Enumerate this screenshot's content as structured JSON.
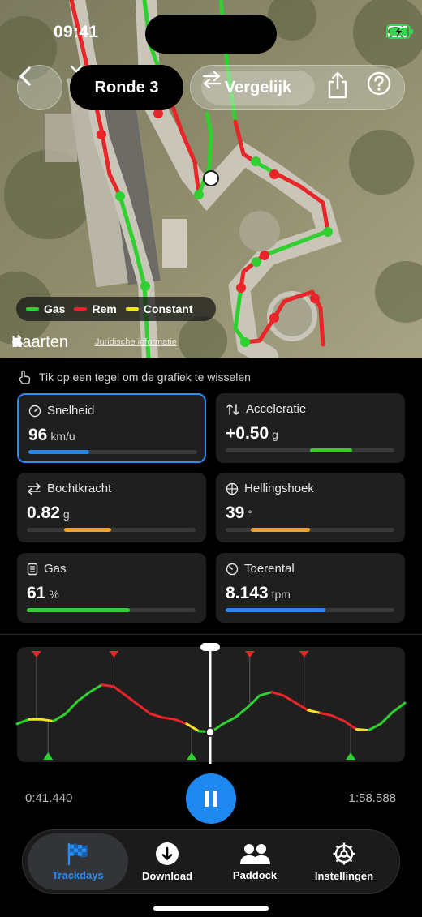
{
  "status": {
    "time": "09:41"
  },
  "header": {
    "lap_label": "Ronde 3",
    "compare_label": "Vergelijk"
  },
  "map": {
    "legend": [
      {
        "label": "Gas",
        "color": "#2fd02f"
      },
      {
        "label": "Rem",
        "color": "#e8262a"
      },
      {
        "label": "Constant",
        "color": "#f2e21f"
      }
    ],
    "maps_brand": "Kaarten",
    "legal_link": "Juridische informatie"
  },
  "hint": "Tik op een tegel om de grafiek te wisselen",
  "tiles": [
    {
      "label": "Snelheid",
      "value": "96",
      "unit": "km/u",
      "icon": "speedometer-icon",
      "bar": {
        "start": 0.0,
        "end": 0.36,
        "color": "#1e88f0"
      },
      "selected": true
    },
    {
      "label": "Acceleratie",
      "value": "+0.50",
      "unit": "g",
      "icon": "arrows-up-down-icon",
      "bar": {
        "start": 0.5,
        "end": 0.75,
        "color": "#2fd02f"
      },
      "selected": false
    },
    {
      "label": "Bochtkracht",
      "value": "0.82",
      "unit": "g",
      "icon": "arrows-left-right-icon",
      "bar": {
        "start": 0.22,
        "end": 0.5,
        "color": "#f0a424"
      },
      "selected": false
    },
    {
      "label": "Hellingshoek",
      "value": "39",
      "unit": "°",
      "icon": "globe-icon",
      "bar": {
        "start": 0.15,
        "end": 0.5,
        "color": "#f0a424"
      },
      "selected": false
    },
    {
      "label": "Gas",
      "value": "61",
      "unit": "%",
      "icon": "throttle-icon",
      "bar": {
        "start": 0.0,
        "end": 0.61,
        "color": "#2fd02f"
      },
      "selected": false
    },
    {
      "label": "Toerental",
      "value": "8.143",
      "unit": "tpm",
      "icon": "gauge-icon",
      "bar": {
        "start": 0.0,
        "end": 0.59,
        "color": "#1e88f0"
      },
      "selected": false
    }
  ],
  "playback": {
    "current_time": "0:41.440",
    "total_time": "1:58.588",
    "progress": 0.5
  },
  "chart_data": {
    "type": "line",
    "series": [
      {
        "values": [
          0.35,
          0.4,
          0.4,
          0.38,
          0.46,
          0.6,
          0.7,
          0.78,
          0.76,
          0.66,
          0.56,
          0.46,
          0.42,
          0.4,
          0.35,
          0.27,
          0.26,
          0.35,
          0.42,
          0.53,
          0.66,
          0.7,
          0.66,
          0.58,
          0.5,
          0.47,
          0.44,
          0.38,
          0.29,
          0.28,
          0.35,
          0.48,
          0.58
        ]
      }
    ],
    "phases": [
      "green",
      "yellow",
      "yellow",
      "green",
      "green",
      "green",
      "green",
      "red",
      "red",
      "red",
      "red",
      "red",
      "red",
      "red",
      "yellow",
      "green",
      "green",
      "green",
      "green",
      "green",
      "green",
      "red",
      "red",
      "red",
      "yellow",
      "red",
      "red",
      "red",
      "yellow",
      "green",
      "green",
      "green",
      "green"
    ],
    "markers": [
      {
        "at": 0.05,
        "kind": "brake"
      },
      {
        "at": 0.08,
        "kind": "throttle"
      },
      {
        "at": 0.25,
        "kind": "brake"
      },
      {
        "at": 0.45,
        "kind": "throttle"
      },
      {
        "at": 0.6,
        "kind": "brake"
      },
      {
        "at": 0.74,
        "kind": "brake"
      },
      {
        "at": 0.86,
        "kind": "throttle"
      }
    ]
  },
  "tabs": [
    {
      "label": "Trackdays",
      "icon": "checkered-flag-icon",
      "active": true
    },
    {
      "label": "Download",
      "icon": "download-icon",
      "active": false
    },
    {
      "label": "Paddock",
      "icon": "people-icon",
      "active": false
    },
    {
      "label": "Instellingen",
      "icon": "gear-icon",
      "active": false
    }
  ]
}
